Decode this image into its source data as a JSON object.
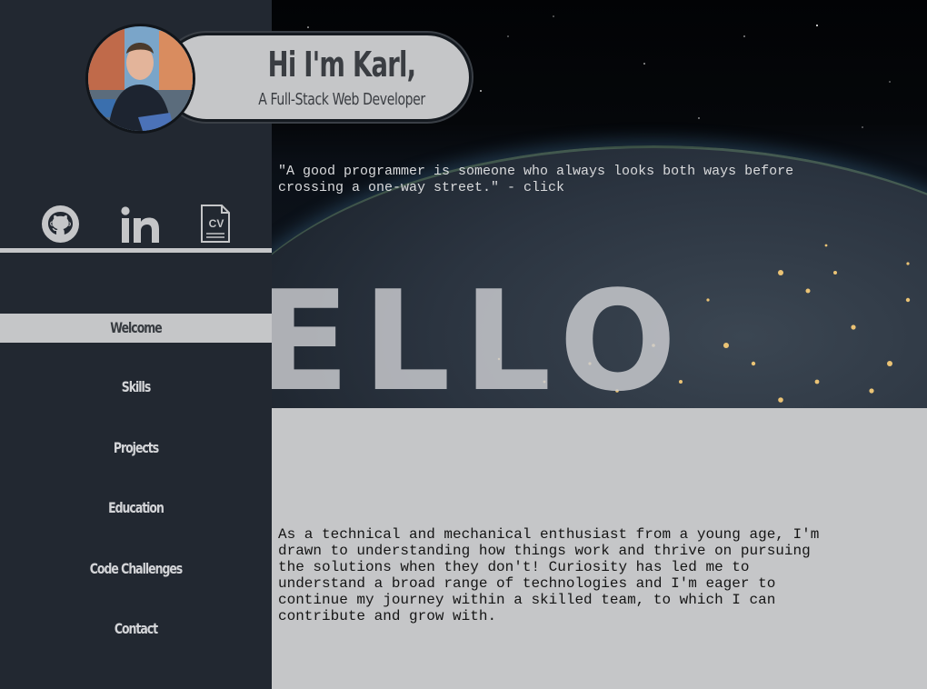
{
  "header": {
    "title": "Hi I'm Karl,",
    "subtitle": "A Full-Stack Web Developer"
  },
  "socials": [
    {
      "icon": "github-icon",
      "label": "GitHub"
    },
    {
      "icon": "linkedin-icon",
      "label": "in"
    },
    {
      "icon": "cv-document-icon",
      "label": "CV"
    }
  ],
  "nav": {
    "items": [
      {
        "label": "Welcome",
        "active": true
      },
      {
        "label": "Skills"
      },
      {
        "label": "Projects"
      },
      {
        "label": "Education"
      },
      {
        "label": "Code Challenges"
      },
      {
        "label": "Contact"
      }
    ]
  },
  "hero": {
    "quote": "\"A good programmer is someone who always looks both ways before crossing a one-way street.\"",
    "quote_link": " - click",
    "big_text": "ELLO"
  },
  "intro": {
    "text": "As a technical and mechanical enthusiast from a young age, I'm drawn to understanding how things work and thrive on pursuing the solutions when they don't! Curiosity has led me to understand a broad range of technologies and I'm eager to continue my journey within a skilled team, to which I can contribute and grow with."
  },
  "colors": {
    "sidebar": "#222831",
    "accent_light": "#c5c6c8",
    "text_dark": "#3a3d42"
  }
}
